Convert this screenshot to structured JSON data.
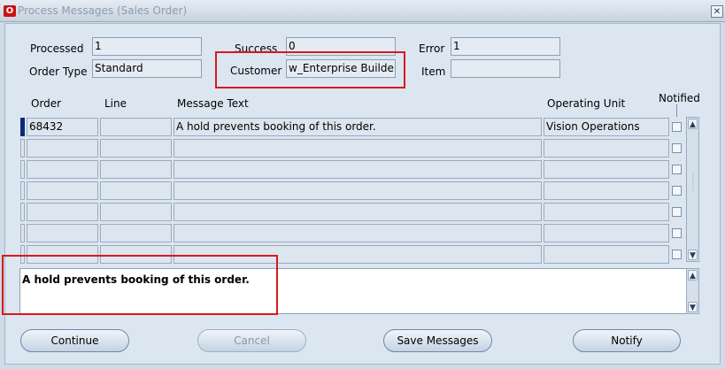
{
  "window": {
    "title": "Process Messages (Sales Order)"
  },
  "header": {
    "processed_label": "Processed",
    "processed_value": "1",
    "success_label": "Success",
    "success_value": "0",
    "error_label": "Error",
    "error_value": "1",
    "order_type_label": "Order Type",
    "order_type_value": "Standard",
    "customer_label": "Customer",
    "customer_value": "w_Enterprise Builder",
    "item_label": "Item",
    "item_value": ""
  },
  "table": {
    "columns": {
      "order": "Order",
      "line": "Line",
      "message_text": "Message Text",
      "operating_unit": "Operating Unit",
      "notified": "Notified"
    },
    "rows": [
      {
        "order": "68432",
        "line": "",
        "message": "A hold prevents booking of this order.",
        "operating_unit": "Vision Operations"
      },
      {
        "order": "",
        "line": "",
        "message": "",
        "operating_unit": ""
      },
      {
        "order": "",
        "line": "",
        "message": "",
        "operating_unit": ""
      },
      {
        "order": "",
        "line": "",
        "message": "",
        "operating_unit": ""
      },
      {
        "order": "",
        "line": "",
        "message": "",
        "operating_unit": ""
      },
      {
        "order": "",
        "line": "",
        "message": "",
        "operating_unit": ""
      },
      {
        "order": "",
        "line": "",
        "message": "",
        "operating_unit": ""
      }
    ]
  },
  "message_detail": "A hold prevents booking of this order.",
  "buttons": {
    "continue": "Continue",
    "cancel": "Cancel",
    "save_messages": "Save Messages",
    "notify": "Notify"
  },
  "colors": {
    "highlight_box": "#d71a1a",
    "active_row_indicator": "#0c2a7a"
  }
}
